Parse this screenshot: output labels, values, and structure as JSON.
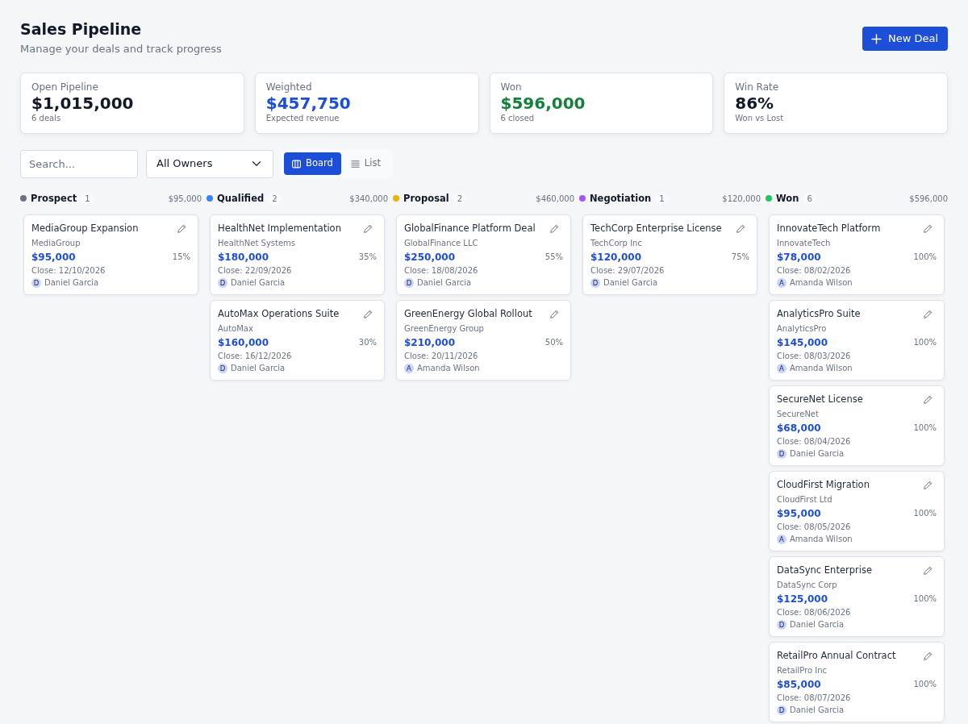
{
  "header": {
    "title": "Sales Pipeline",
    "subtitle": "Manage your deals and track progress",
    "new_button": "New Deal"
  },
  "stats": [
    {
      "label": "Open Pipeline",
      "value": "$1,015,000",
      "note": "6 deals",
      "color": "#111827"
    },
    {
      "label": "Weighted",
      "value": "$457,750",
      "note": "Expected revenue",
      "color": "#1d4ed8"
    },
    {
      "label": "Won",
      "value": "$596,000",
      "note": "6 closed",
      "color": "#15803d"
    },
    {
      "label": "Win Rate",
      "value": "86%",
      "note": "Won vs Lost",
      "color": "#111827"
    }
  ],
  "toolbar": {
    "search": {
      "placeholder": "Search..."
    },
    "owner_filter": {
      "value": "All Owners"
    },
    "views": [
      {
        "label": "Board",
        "selected": true
      },
      {
        "label": "List",
        "selected": false
      }
    ]
  },
  "columns": [
    {
      "name": "Prospect",
      "color": "#6b7280",
      "count": "1",
      "total": "$95,000",
      "deals": [
        {
          "title": "MediaGroup Expansion",
          "company": "MediaGroup",
          "amount": "$95,000",
          "probability": "15%",
          "close": "Close: 12/10/2026",
          "owner_initial": "D",
          "owner": "Daniel Garcia"
        }
      ]
    },
    {
      "name": "Qualified",
      "color": "#3b82f6",
      "count": "2",
      "total": "$340,000",
      "deals": [
        {
          "title": "HealthNet Implementation",
          "company": "HealthNet Systems",
          "amount": "$180,000",
          "probability": "35%",
          "close": "Close: 22/09/2026",
          "owner_initial": "D",
          "owner": "Daniel Garcia"
        },
        {
          "title": "AutoMax Operations Suite",
          "company": "AutoMax",
          "amount": "$160,000",
          "probability": "30%",
          "close": "Close: 16/12/2026",
          "owner_initial": "D",
          "owner": "Daniel Garcia"
        }
      ]
    },
    {
      "name": "Proposal",
      "color": "#eab308",
      "count": "2",
      "total": "$460,000",
      "deals": [
        {
          "title": "GlobalFinance Platform Deal",
          "company": "GlobalFinance LLC",
          "amount": "$250,000",
          "probability": "55%",
          "close": "Close: 18/08/2026",
          "owner_initial": "D",
          "owner": "Daniel Garcia"
        },
        {
          "title": "GreenEnergy Global Rollout",
          "company": "GreenEnergy Group",
          "amount": "$210,000",
          "probability": "50%",
          "close": "Close: 20/11/2026",
          "owner_initial": "A",
          "owner": "Amanda Wilson"
        }
      ]
    },
    {
      "name": "Negotiation",
      "color": "#a855f7",
      "count": "1",
      "total": "$120,000",
      "deals": [
        {
          "title": "TechCorp Enterprise License",
          "company": "TechCorp Inc",
          "amount": "$120,000",
          "probability": "75%",
          "close": "Close: 29/07/2026",
          "owner_initial": "D",
          "owner": "Daniel Garcia"
        }
      ]
    },
    {
      "name": "Won",
      "color": "#22c55e",
      "count": "6",
      "total": "$596,000",
      "deals": [
        {
          "title": "InnovateTech Platform",
          "company": "InnovateTech",
          "amount": "$78,000",
          "probability": "100%",
          "close": "Close: 08/02/2026",
          "owner_initial": "A",
          "owner": "Amanda Wilson"
        },
        {
          "title": "AnalyticsPro Suite",
          "company": "AnalyticsPro",
          "amount": "$145,000",
          "probability": "100%",
          "close": "Close: 08/03/2026",
          "owner_initial": "A",
          "owner": "Amanda Wilson"
        },
        {
          "title": "SecureNet License",
          "company": "SecureNet",
          "amount": "$68,000",
          "probability": "100%",
          "close": "Close: 08/04/2026",
          "owner_initial": "D",
          "owner": "Daniel Garcia"
        },
        {
          "title": "CloudFirst Migration",
          "company": "CloudFirst Ltd",
          "amount": "$95,000",
          "probability": "100%",
          "close": "Close: 08/05/2026",
          "owner_initial": "A",
          "owner": "Amanda Wilson"
        },
        {
          "title": "DataSync Enterprise",
          "company": "DataSync Corp",
          "amount": "$125,000",
          "probability": "100%",
          "close": "Close: 08/06/2026",
          "owner_initial": "D",
          "owner": "Daniel Garcia"
        },
        {
          "title": "RetailPro Annual Contract",
          "company": "RetailPro Inc",
          "amount": "$85,000",
          "probability": "100%",
          "close": "Close: 08/07/2026",
          "owner_initial": "D",
          "owner": "Daniel Garcia"
        }
      ]
    }
  ]
}
